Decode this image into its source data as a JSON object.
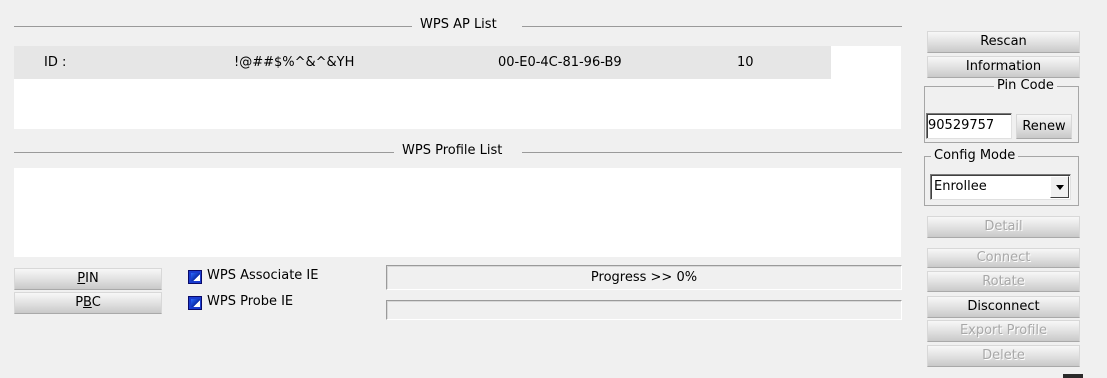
{
  "ap_section": {
    "title": "WPS AP List",
    "row": {
      "id_label": "ID :",
      "ssid": "!@##$%^&^&YH",
      "mac": "00-E0-4C-81-96-B9",
      "channel": "10"
    }
  },
  "profile_section": {
    "title": "WPS Profile List"
  },
  "side_buttons": {
    "rescan": "Rescan",
    "information": "Information",
    "detail": "Detail",
    "connect": "Connect",
    "rotate": "Rotate",
    "disconnect": "Disconnect",
    "export_profile": "Export Profile",
    "delete": "Delete"
  },
  "pin_code": {
    "legend": "Pin Code",
    "value": "90529757",
    "renew": "Renew"
  },
  "config_mode": {
    "legend": "Config Mode",
    "selected": "Enrollee"
  },
  "bottom": {
    "pin_button": {
      "underlined": "P",
      "rest": "IN"
    },
    "pbc_button": {
      "pre": "P",
      "underlined": "B",
      "post": "C"
    },
    "associate_ie": {
      "label": "WPS Associate IE",
      "checked": true
    },
    "probe_ie": {
      "label": "WPS Probe IE",
      "checked": true
    },
    "progress_text": "Progress >> 0%",
    "progress_fraction": 0
  },
  "colors": {
    "window_bg": "#f0f0f0",
    "checkbox": "#1a3cd0",
    "list_bg": "#ffffff"
  }
}
